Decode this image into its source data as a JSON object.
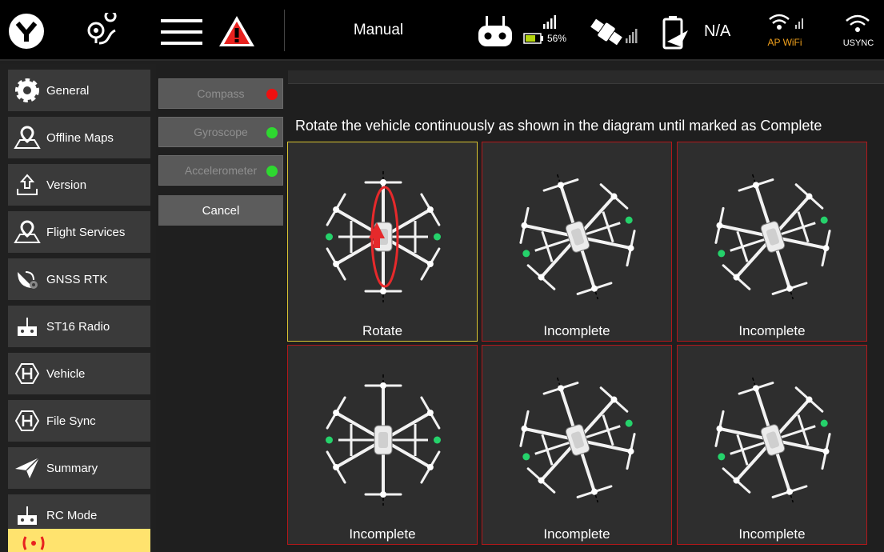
{
  "topbar": {
    "mode": "Manual",
    "battery_percent": "56%",
    "gps_status": "N/A",
    "ap_wifi_label": "AP WiFi",
    "usync_label": "USYNC",
    "colors": {
      "warning": "#e8221f",
      "battery_fill": "#b5d50f",
      "ap_wifi": "#f0a01c"
    }
  },
  "sidebar": {
    "items": [
      {
        "label": "General",
        "icon": "gear-icon"
      },
      {
        "label": "Offline Maps",
        "icon": "map-pin-icon"
      },
      {
        "label": "Version",
        "icon": "upload-icon"
      },
      {
        "label": "Flight Services",
        "icon": "map-pin-icon"
      },
      {
        "label": "GNSS RTK",
        "icon": "satellite-gear-icon"
      },
      {
        "label": "ST16 Radio",
        "icon": "remote-controller-icon"
      },
      {
        "label": "Vehicle",
        "icon": "hexagon-h-icon"
      },
      {
        "label": "File Sync",
        "icon": "hexagon-h-icon"
      },
      {
        "label": "Summary",
        "icon": "paper-plane-icon"
      },
      {
        "label": "RC Mode",
        "icon": "remote-controller-icon"
      }
    ]
  },
  "sensors": {
    "items": [
      {
        "label": "Compass",
        "status_color": "#ef1010"
      },
      {
        "label": "Gyroscope",
        "status_color": "#2ed830"
      },
      {
        "label": "Accelerometer",
        "status_color": "#2ed830"
      }
    ],
    "cancel_label": "Cancel"
  },
  "calibration": {
    "instruction": "Rotate the vehicle continuously as shown in the diagram until marked as Complete",
    "tiles": [
      {
        "label": "Rotate",
        "state": "active",
        "orientation": "level",
        "show_rotate_arrow": true
      },
      {
        "label": "Incomplete",
        "state": "incomplete",
        "orientation": "tilted"
      },
      {
        "label": "Incomplete",
        "state": "incomplete",
        "orientation": "tilted"
      },
      {
        "label": "Incomplete",
        "state": "incomplete",
        "orientation": "level"
      },
      {
        "label": "Incomplete",
        "state": "incomplete",
        "orientation": "tilted"
      },
      {
        "label": "Incomplete",
        "state": "incomplete",
        "orientation": "tilted"
      }
    ]
  }
}
